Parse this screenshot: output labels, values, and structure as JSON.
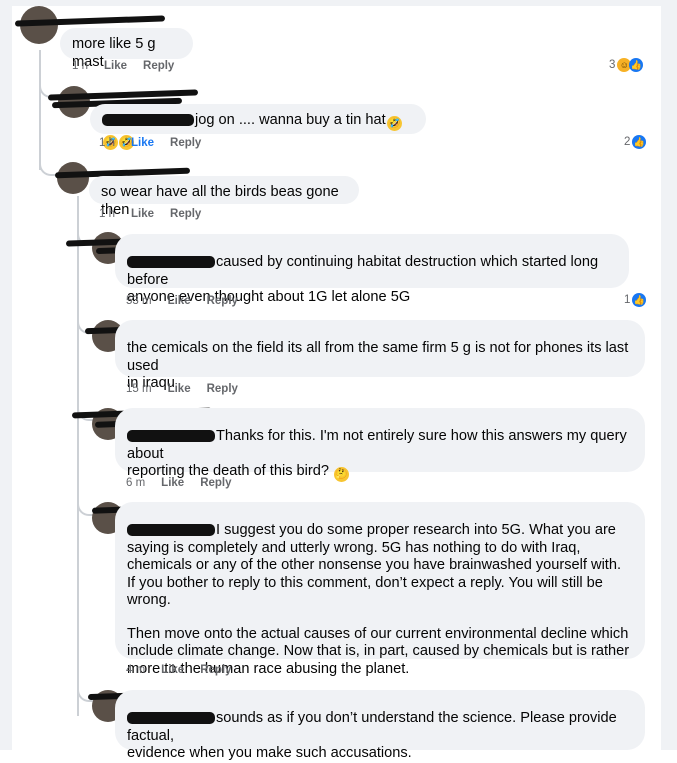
{
  "comments": [
    {
      "text": "more like 5 g mast",
      "time": "1 h",
      "like": "Like",
      "reply": "Reply",
      "reaction_count": "3"
    },
    {
      "text": "jog on .... wanna buy a tin hat",
      "emojis": [
        "🤣",
        "🤣",
        "🤣"
      ],
      "time": "1 h",
      "like": "Like",
      "reply": "Reply",
      "reaction_count": "2",
      "liked": true
    },
    {
      "text": "so wear have all the birds beas gone then",
      "time": "1 h",
      "like": "Like",
      "reply": "Reply"
    },
    {
      "text_line1": "caused by continuing habitat destruction which started long before",
      "text_line2": "anyone even thought about 1G let alone 5G",
      "time": "53 m",
      "like": "Like",
      "reply": "Reply",
      "reaction_count": "1"
    },
    {
      "text_line1": "the cemicals on the field  its all from the same firm  5 g is not for phones its last used",
      "text_line2": "in iraqu",
      "time": "15 m",
      "like": "Like",
      "reply": "Reply"
    },
    {
      "text_line1": "Thanks for this. I'm not entirely sure how this answers my query about",
      "text_line2": "reporting the death of this bird?",
      "emoji": "🤔",
      "time": "6 m",
      "like": "Like",
      "reply": "Reply"
    },
    {
      "para1_line1": "I suggest you do some proper research into 5G. What you are saying",
      "para1_rest": "is completely and utterly wrong. 5G has nothing to do with Iraq, chemicals or any of the other nonsense you have brainwashed yourself with. If you bother to reply to this comment, don’t expect a reply. You will still be wrong.",
      "para2": "Then move onto the actual causes of our current environmental decline which include climate change. Now that is, in part, caused by chemicals but is rather more to the human race abusing the planet.",
      "time": "4 m",
      "like": "Like",
      "reply": "Reply"
    },
    {
      "text_line1": "sounds as if you don’t understand the science. Please provide factual,",
      "text_line2": "evidence when you make such accusations."
    }
  ],
  "icons": {
    "like": "like-icon",
    "haha": "haha-icon"
  },
  "colors": {
    "bubble": "#f0f2f5",
    "meta": "#65676b",
    "link": "#1877f2"
  }
}
